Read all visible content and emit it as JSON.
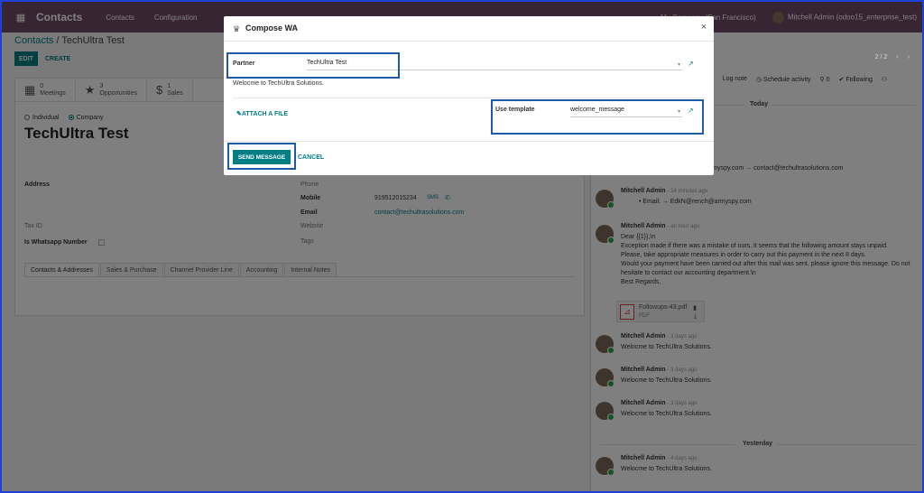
{
  "navbar": {
    "title": "Contacts",
    "menu": [
      "Contacts",
      "Configuration"
    ],
    "company": "My Company (San Francisco)",
    "user": "Mitchell Admin (odoo15_enterprise_test)"
  },
  "breadcrumb": {
    "parent": "Contacts",
    "current": "TechUltra Test"
  },
  "controls": {
    "edit": "EDIT",
    "create": "CREATE"
  },
  "stats": [
    {
      "icon": "calendar-icon",
      "count": "0",
      "label": "Meetings"
    },
    {
      "icon": "star-icon",
      "count": "3",
      "label": "Opportunities"
    },
    {
      "icon": "dollar-icon",
      "count": "1",
      "label": "Sales"
    }
  ],
  "form": {
    "type_individual": "Individual",
    "type_company": "Company",
    "name": "TechUltra Test",
    "labels": {
      "address": "Address",
      "tax_id": "Tax ID",
      "is_whatsapp": "Is Whatsapp Number",
      "phone": "Phone",
      "mobile": "Mobile",
      "email": "Email",
      "website": "Website",
      "tags": "Tags"
    },
    "mobile": "919512015234",
    "sms": "SMS",
    "email": "contact@techultrasolutions.com"
  },
  "tabs": [
    "Contacts & Addresses",
    "Sales & Purchase",
    "Channel Provider Line",
    "Accounting",
    "Internal Notes"
  ],
  "chatter": {
    "pager": "2 / 2",
    "actions": {
      "send": "age",
      "log": "Log note",
      "schedule": "Schedule activity",
      "followers": "0",
      "following": "Following"
    },
    "today": "Today",
    "yesterday": "Yesterday",
    "tracking": "rmyspy.com → contact@techultrasolutions.com",
    "messages": [
      {
        "author": "Mitchell Admin",
        "time": "- 24 minutes ago",
        "body": "• Email: → EdkN@rench@armyspy.com"
      },
      {
        "author": "Mitchell Admin",
        "time": "- an hour ago",
        "body": "Dear {{1}},\\n\nException made if there was a mistake of ours, it seems that the following amount stays unpaid.\nPlease, take appropriate measures in order to carry out this payment in the next 8 days.\nWould your payment have been carried out after this mail was sent, please ignore this message. Do not hesitate to contact our accounting department.\\n\nBest Regards,"
      },
      {
        "author": "Mitchell Admin",
        "time": "- 3 days ago",
        "body": "Welocme to TechUltra Solutions."
      },
      {
        "author": "Mitchell Admin",
        "time": "- 3 days ago",
        "body": "Welocme to TechUltra Solutions."
      },
      {
        "author": "Mitchell Admin",
        "time": "- 3 days ago",
        "body": "Welocme to TechUltra Solutions."
      },
      {
        "author": "Mitchell Admin",
        "time": "- 4 days ago",
        "body": "Welocme to TechUltra Solutions."
      }
    ],
    "attachment": {
      "name": "Followups-43.pdf",
      "ext": "PDF"
    }
  },
  "modal": {
    "title": "Compose WA",
    "partner_label": "Partner",
    "partner_value": "TechUltra Test",
    "message": "Welocme to TechUltra Solutions.",
    "attach_label": "ATTACH A FILE",
    "template_label": "Use template",
    "template_value": "welcome_message",
    "send_label": "SEND MESSAGE",
    "cancel_label": "CANCEL"
  }
}
